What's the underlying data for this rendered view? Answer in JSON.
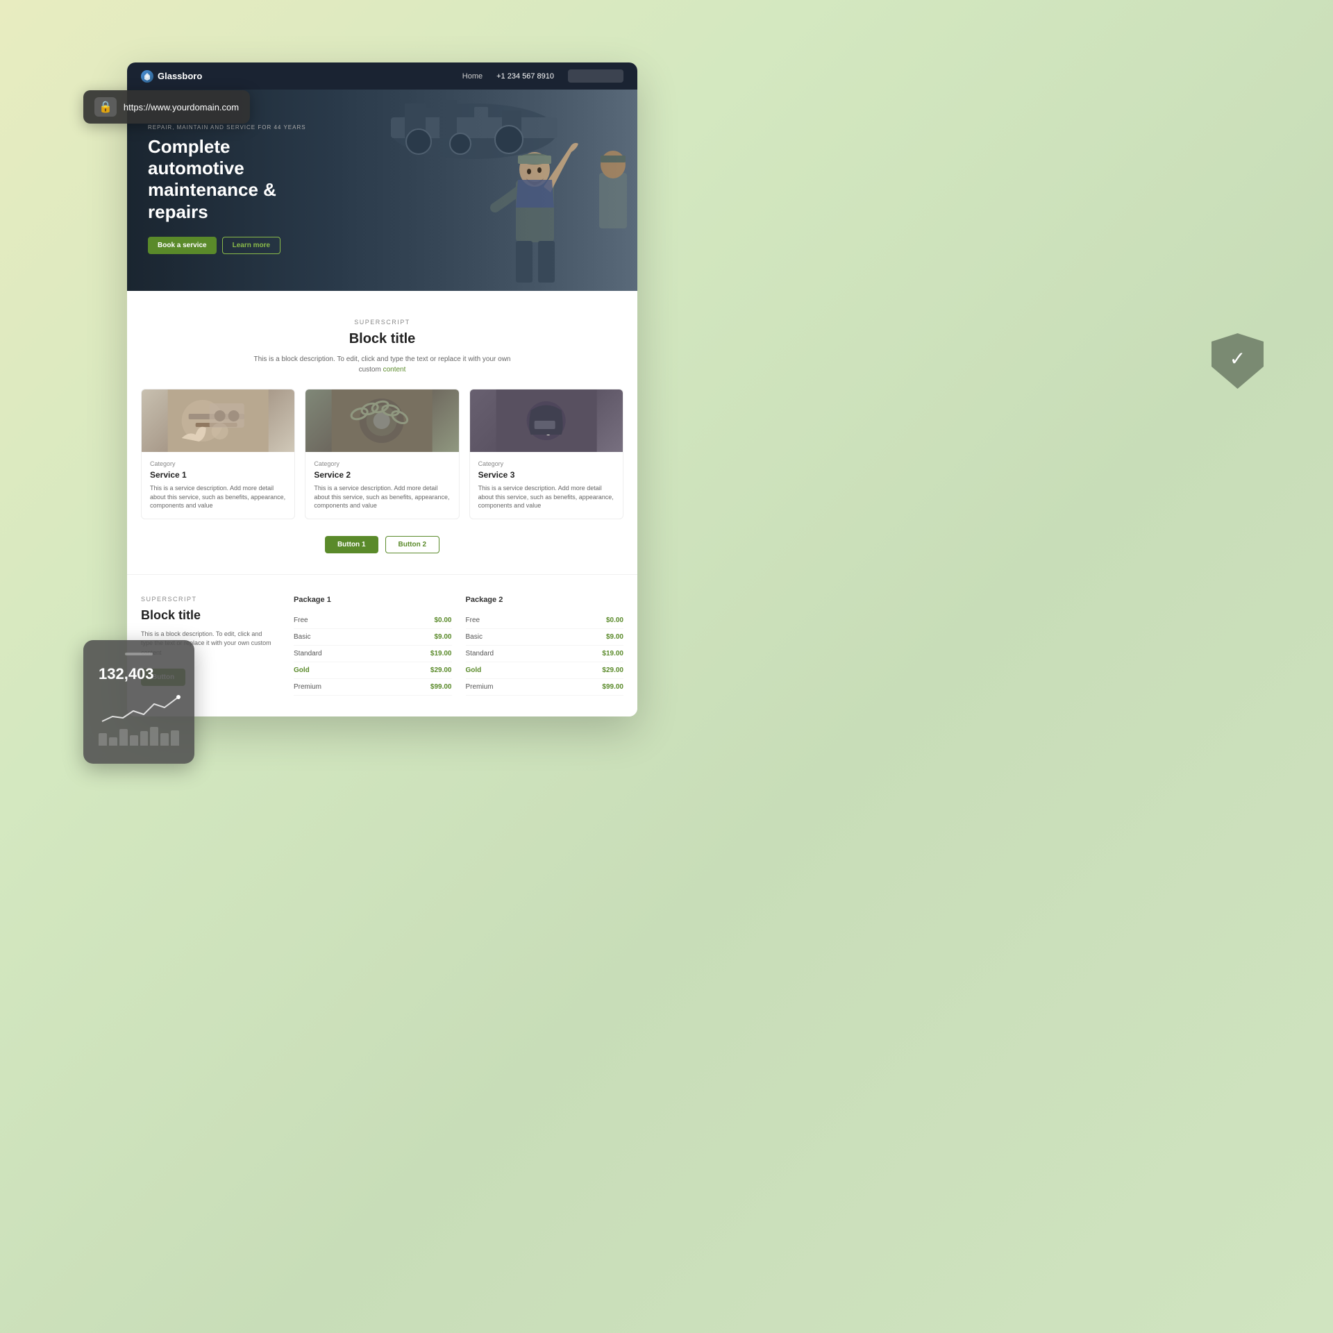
{
  "background": {
    "gradient_start": "#e8ecc0",
    "gradient_end": "#d0e4c0"
  },
  "url_bar": {
    "url": "https://www.yourdomain.com",
    "lock_icon": "🔒"
  },
  "site": {
    "navbar": {
      "logo_text": "Glassboro",
      "nav_home": "Home",
      "phone": "+1 234 567 8910",
      "search_placeholder": ""
    },
    "hero": {
      "superscript": "REPAIR, MAINTAIN AND SERVICE FOR 44 YEARS",
      "title": "Complete automotive maintenance & repairs",
      "cta_primary": "Book a service",
      "cta_secondary": "Learn more"
    },
    "services": {
      "superscript": "SUPERSCRIPT",
      "title": "Block title",
      "description": "This is a block description. To edit, click and type the text or replace it with your own custom",
      "description_link": "content",
      "cards": [
        {
          "category": "Category",
          "name": "Service 1",
          "description": "This is a service description. Add more detail about this service, such as benefits, appearance, components and value"
        },
        {
          "category": "Category",
          "name": "Service 2",
          "description": "This is a service description. Add more detail about this service, such as benefits, appearance, components and value"
        },
        {
          "category": "Category",
          "name": "Service 3",
          "description": "This is a service description. Add more detail about this service, such as benefits, appearance, components and value"
        }
      ],
      "button1": "Button 1",
      "button2": "Button 2"
    },
    "pricing": {
      "superscript": "SUPERSCRIPT",
      "title": "Block title",
      "description": "This is a block description. To edit, click and type the text or replace it with your own custom content",
      "button": "Button",
      "package1": {
        "title": "Package 1",
        "rows": [
          {
            "label": "Free",
            "value": "$0.00"
          },
          {
            "label": "Basic",
            "value": "$9.00"
          },
          {
            "label": "Standard",
            "value": "$19.00"
          },
          {
            "label": "Gold",
            "value": "$29.00"
          },
          {
            "label": "Premium",
            "value": "$99.00"
          }
        ]
      },
      "package2": {
        "title": "Package 2",
        "rows": [
          {
            "label": "Free",
            "value": "$0.00"
          },
          {
            "label": "Basic",
            "value": "$9.00"
          },
          {
            "label": "Standard",
            "value": "$19.00"
          },
          {
            "label": "Gold",
            "value": "$29.00"
          },
          {
            "label": "Premium",
            "value": "$99.00"
          }
        ]
      }
    }
  },
  "stats_card": {
    "number": "132,403"
  },
  "shield": {
    "icon": "✓"
  }
}
